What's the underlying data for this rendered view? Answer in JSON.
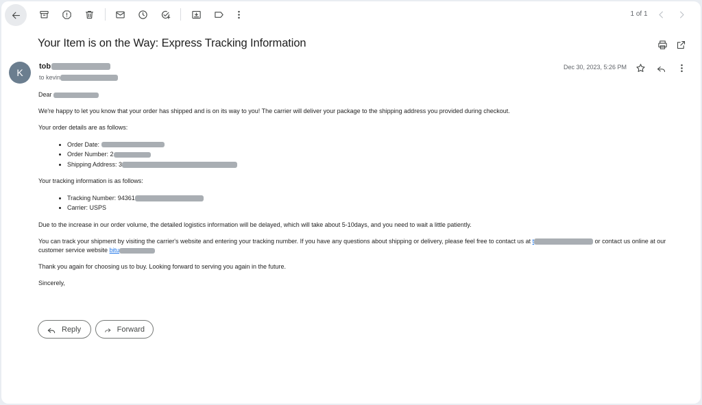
{
  "toolbar": {
    "icons": [
      "back-arrow-icon",
      "archive-icon",
      "report-spam-icon",
      "delete-icon",
      "mark-unread-icon",
      "snooze-icon",
      "add-task-icon",
      "move-to-icon",
      "label-icon",
      "more-vert-icon"
    ],
    "pager": "1 of 1"
  },
  "email": {
    "subject": "Your Item is on the Way: Express Tracking Information",
    "sender": {
      "avatar_letter": "K",
      "avatar_color": "#6b7e8f",
      "name_visible": "tob",
      "to_prefix": "to kevin"
    },
    "date": "Dec 30, 2023, 5:26 PM",
    "body": {
      "greeting": "Dear",
      "intro": "We're happy to let you know that your order has shipped and is on its way to you! The carrier will deliver your package to the shipping address you provided during checkout.",
      "order_heading": "Your order details are as follows:",
      "order_items": [
        {
          "label": "Order Date: "
        },
        {
          "label": "Order Number: 2"
        },
        {
          "label": "Shipping Address: 3"
        }
      ],
      "tracking_heading": "Your tracking information is as follows:",
      "tracking_items": [
        {
          "label": "Tracking Number: 94361"
        },
        {
          "label": "Carrier: USPS"
        }
      ],
      "delay_notice": "Due to the increase in our order volume, the detailed logistics information will be delayed, which will take about 5-10days, and you need to wait a little patiently.",
      "contact_part1": "You can track your shipment by visiting the carrier's website and entering your tracking number. If you have any questions about shipping or delivery, please feel free to contact us at",
      "contact_part2": "or contact us online at our customer service website",
      "contact_link_fragment": "t",
      "website_link_fragment": "bitu",
      "thanks": "Thank you again for choosing us to buy. Looking forward to serving you again in the future.",
      "closing": "Sincerely,"
    },
    "actions": {
      "reply": "Reply",
      "forward": "Forward"
    }
  }
}
